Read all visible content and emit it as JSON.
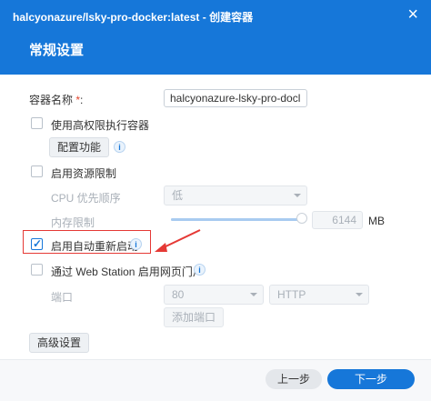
{
  "window": {
    "title": "halcyonazure/lsky-pro-docker:latest - 创建容器",
    "close_icon": "×"
  },
  "section_title": "常规设置",
  "container_name": {
    "label": "容器名称",
    "required_mark": "*",
    "colon": ":",
    "value": "halcyonazure-lsky-pro-docl"
  },
  "privileged": {
    "label": "使用高权限执行容器",
    "checked": false,
    "config_button": "配置功能",
    "info_icon": "i"
  },
  "resource_limit": {
    "label": "启用资源限制",
    "checked": false,
    "cpu_label": "CPU 优先顺序",
    "cpu_value": "低",
    "memory_label": "内存限制",
    "memory_value": "6144",
    "memory_unit": "MB",
    "memory_slider_level": 1.0
  },
  "auto_restart": {
    "label": "启用自动重新启动",
    "checked": true,
    "check_glyph": "✓",
    "info_icon": "i"
  },
  "web_station": {
    "label": "通过 Web Station 启用网页门户",
    "checked": false,
    "info_icon": "i",
    "port_label": "端口",
    "port_value": "80",
    "protocol_value": "HTTP",
    "add_port_button": "添加端口"
  },
  "advanced_button": "高级设置",
  "footer": {
    "prev_button": "上一步",
    "next_button": "下一步"
  },
  "colors": {
    "header_bg": "#1677d9",
    "primary_button": "#1677d9",
    "annotation_red": "#e53935"
  }
}
